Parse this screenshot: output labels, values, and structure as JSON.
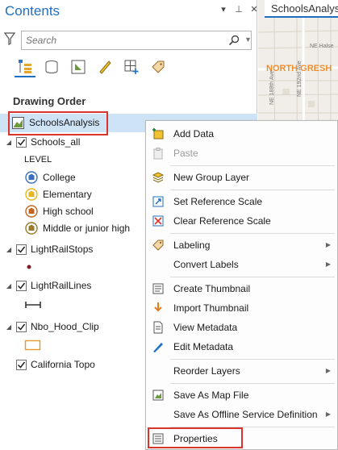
{
  "pane": {
    "title": "Contents",
    "controls": [
      "▾",
      "⊥",
      "✕"
    ],
    "search_placeholder": "Search",
    "toolbar_icons": [
      "list-by-drawing-order-icon",
      "list-by-data-source-icon",
      "list-by-selection-icon",
      "list-by-editing-icon",
      "list-by-snapping-icon",
      "list-by-labeling-icon"
    ],
    "section_heading": "Drawing Order"
  },
  "tree": {
    "map_name": "SchoolsAnalysis",
    "schools_layer": "Schools_all",
    "legend_heading": "LEVEL",
    "legend_items": [
      "College",
      "Elementary",
      "High school",
      "Middle or junior high"
    ],
    "legend_colors": [
      "#3a6fbf",
      "#e3b622",
      "#c4661f",
      "#9a7a2e"
    ],
    "light_rail_stops": "LightRailStops",
    "light_rail_lines": "LightRailLines",
    "hood_clip": "Nbo_Hood_Clip",
    "basemap": "California Topo"
  },
  "map": {
    "tab_title": "SchoolsAnalysis",
    "street_label_1": "NE Halse",
    "street_label_2": "NE 192nd Ave",
    "street_label_3": "NE 188th Ave",
    "area_label": "NORTH GRESH"
  },
  "menu": {
    "items": [
      {
        "label": "Add Data",
        "icon": "add-data-icon",
        "disabled": false,
        "submenu": false
      },
      {
        "label": "Paste",
        "icon": "paste-icon",
        "disabled": true,
        "submenu": false
      },
      {
        "label": "New Group Layer",
        "icon": "group-layer-icon",
        "disabled": false,
        "submenu": false
      },
      {
        "label": "Set Reference Scale",
        "icon": "set-scale-icon",
        "disabled": false,
        "submenu": false
      },
      {
        "label": "Clear Reference Scale",
        "icon": "clear-scale-icon",
        "disabled": false,
        "submenu": false
      },
      {
        "label": "Labeling",
        "icon": "labeling-icon",
        "disabled": false,
        "submenu": true
      },
      {
        "label": "Convert Labels",
        "icon": "",
        "disabled": false,
        "submenu": true
      },
      {
        "label": "Create Thumbnail",
        "icon": "thumbnail-icon",
        "disabled": false,
        "submenu": false
      },
      {
        "label": "Import Thumbnail",
        "icon": "import-icon",
        "disabled": false,
        "submenu": false
      },
      {
        "label": "View Metadata",
        "icon": "metadata-icon",
        "disabled": false,
        "submenu": false
      },
      {
        "label": "Edit Metadata",
        "icon": "edit-icon",
        "disabled": false,
        "submenu": false
      },
      {
        "label": "Reorder Layers",
        "icon": "",
        "disabled": false,
        "submenu": true
      },
      {
        "label": "Save As Map File",
        "icon": "save-map-icon",
        "disabled": false,
        "submenu": false
      },
      {
        "label": "Save As Offline Service Definition",
        "icon": "",
        "disabled": false,
        "submenu": true
      },
      {
        "label": "Properties",
        "icon": "properties-icon",
        "disabled": false,
        "submenu": false
      }
    ]
  },
  "colors": {
    "accent": "#1d6fc4",
    "selection": "#cfe3f7",
    "highlight": "#d9342b"
  }
}
